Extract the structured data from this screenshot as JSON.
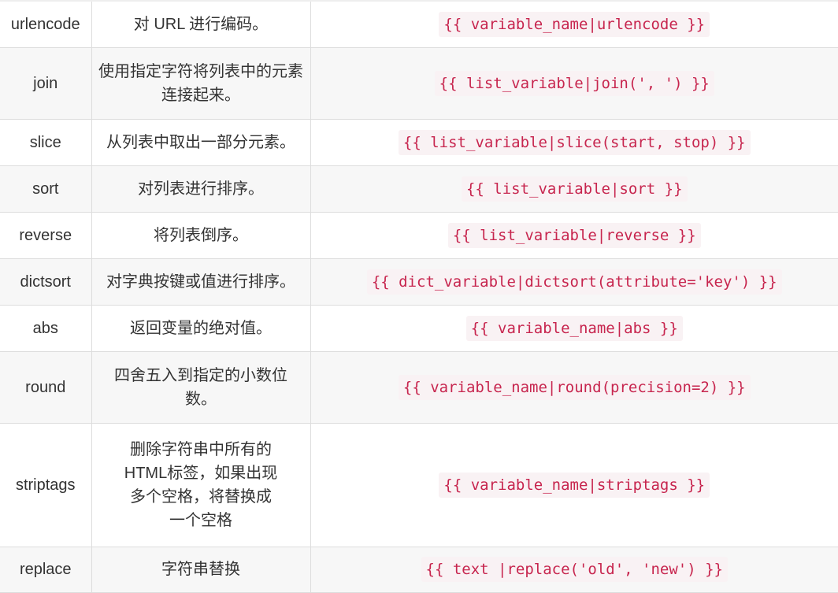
{
  "rows": [
    {
      "name": "urlencode",
      "desc": "对 URL 进行编码。",
      "example": "{{ variable_name|urlencode }}"
    },
    {
      "name": "join",
      "desc": "使用指定字符将列表中的元素连接起来。",
      "example": "{{ list_variable|join(', ') }}"
    },
    {
      "name": "slice",
      "desc": "从列表中取出一部分元素。",
      "example": "{{ list_variable|slice(start, stop) }}"
    },
    {
      "name": "sort",
      "desc": "对列表进行排序。",
      "example": "{{ list_variable|sort }}"
    },
    {
      "name": "reverse",
      "desc": "将列表倒序。",
      "example": "{{ list_variable|reverse }}"
    },
    {
      "name": "dictsort",
      "desc": "对字典按键或值进行排序。",
      "example": "{{ dict_variable|dictsort(attribute='key') }}"
    },
    {
      "name": "abs",
      "desc": "返回变量的绝对值。",
      "example": "{{ variable_name|abs }}"
    },
    {
      "name": "round",
      "desc": "四舍五入到指定的小数位数。",
      "example": "{{ variable_name|round(precision=2) }}"
    },
    {
      "name": "striptags",
      "desc": "删除字符串中所有的HTML标签，如果出现多个空格，将替换成一个空格",
      "example": "{{ variable_name|striptags }}"
    },
    {
      "name": "replace",
      "desc": "字符串替换",
      "example": "{{ text |replace('old', 'new') }}"
    }
  ]
}
